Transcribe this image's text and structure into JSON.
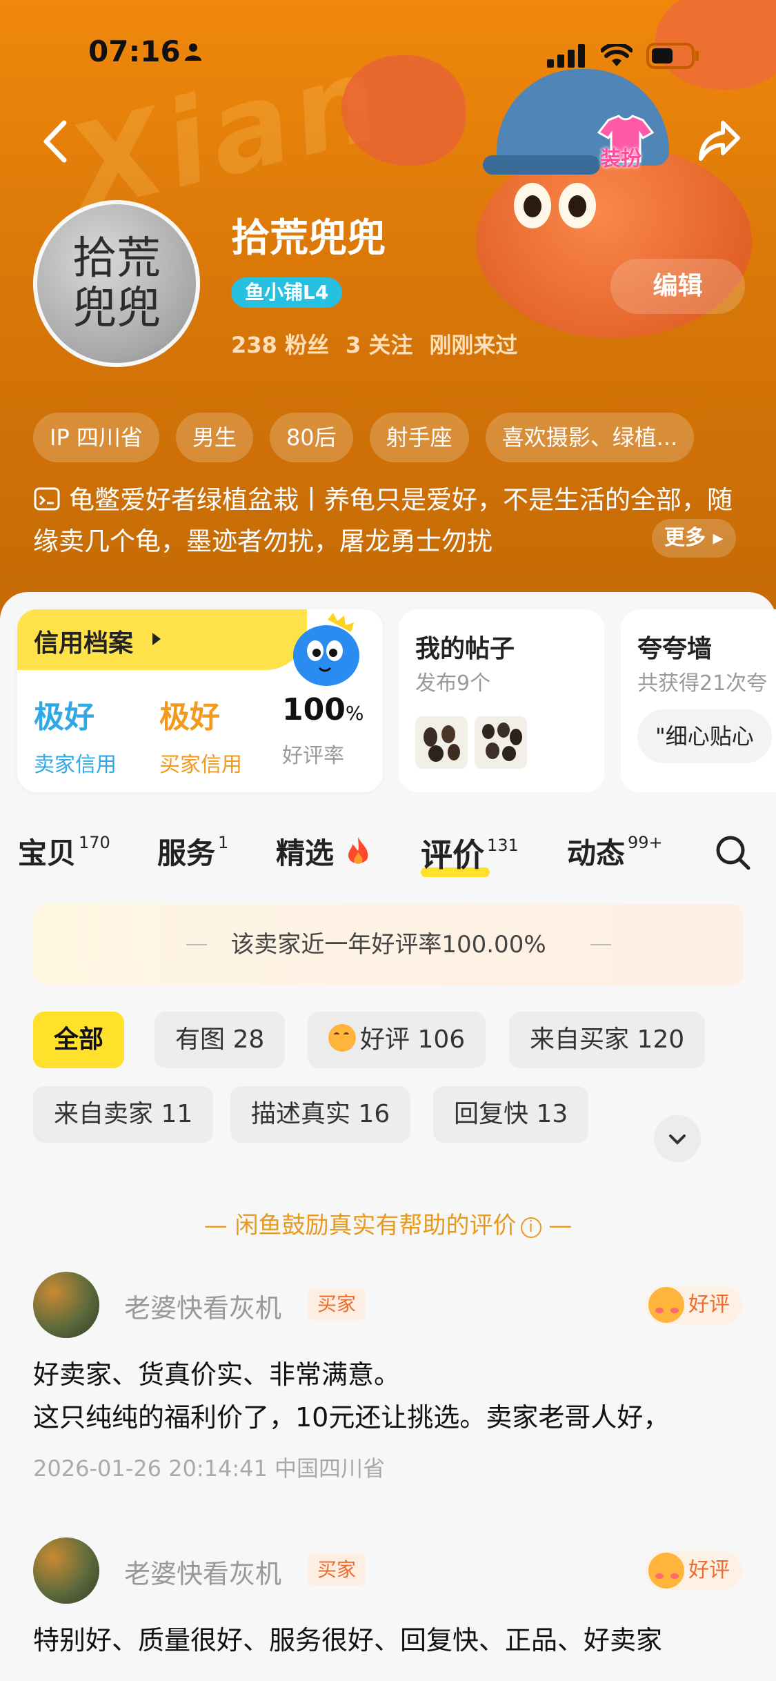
{
  "status_bar": {
    "time": "07:16"
  },
  "header": {
    "dress_label": "装扮",
    "username": "拾荒兜兜",
    "avatar_text": "拾荒兜兜",
    "level_badge": "鱼小铺L4",
    "stats": {
      "fans": "238 粉丝",
      "follows": "3 关注",
      "last_seen": "刚刚来过"
    },
    "edit_label": "编辑",
    "tags": [
      "IP 四川省",
      "男生",
      "80后",
      "射手座",
      "喜欢摄影、绿植..."
    ],
    "bio": "龟鳖爱好者绿植盆栽丨养龟只是爱好，不是生活的全部，随缘卖几个龟，墨迹者勿扰，屠龙勇士勿扰",
    "more_label": "更多"
  },
  "cards": {
    "credit": {
      "title": "信用档案",
      "seller": {
        "value": "极好",
        "label": "卖家信用"
      },
      "buyer": {
        "value": "极好",
        "label": "买家信用"
      },
      "rate": {
        "value": "100",
        "unit": "%",
        "label": "好评率"
      }
    },
    "posts": {
      "title": "我的帖子",
      "subtitle": "发布9个"
    },
    "wall": {
      "title": "夸夸墙",
      "subtitle": "共获得21次夸",
      "chip": "\"细心贴心"
    }
  },
  "tabs": [
    {
      "label": "宝贝",
      "count": "170"
    },
    {
      "label": "服务",
      "count": "1"
    },
    {
      "label": "精选",
      "count": ""
    },
    {
      "label": "评价",
      "count": "131"
    },
    {
      "label": "动态",
      "count": "99+"
    }
  ],
  "active_tab": "评价",
  "rate_banner": "该卖家近一年好评率100.00%",
  "filters": [
    "全部",
    "有图 28",
    "好评 106",
    "来自买家 120",
    "来自卖家 11",
    "描述真实 16",
    "回复快 13"
  ],
  "encourage": "闲鱼鼓励真实有帮助的评价",
  "reviews": [
    {
      "name": "老婆快看灰机",
      "role": "买家",
      "rating": "好评",
      "text": "好卖家、货真价实、非常满意。\n这只纯纯的福利价了，10元还让挑选。卖家老哥人好，",
      "meta": "2026-01-26 20:14:41 中国四川省"
    },
    {
      "name": "老婆快看灰机",
      "role": "买家",
      "rating": "好评",
      "text": "特别好、质量很好、服务很好、回复快、正品、好卖家",
      "meta": ""
    }
  ],
  "colors": {
    "accent_yellow": "#ffe02a",
    "header_orange": "#e07f0a",
    "level_blue": "#27c0e0",
    "seller_blue": "#2fa9e6",
    "buyer_orange": "#f39a1a"
  }
}
